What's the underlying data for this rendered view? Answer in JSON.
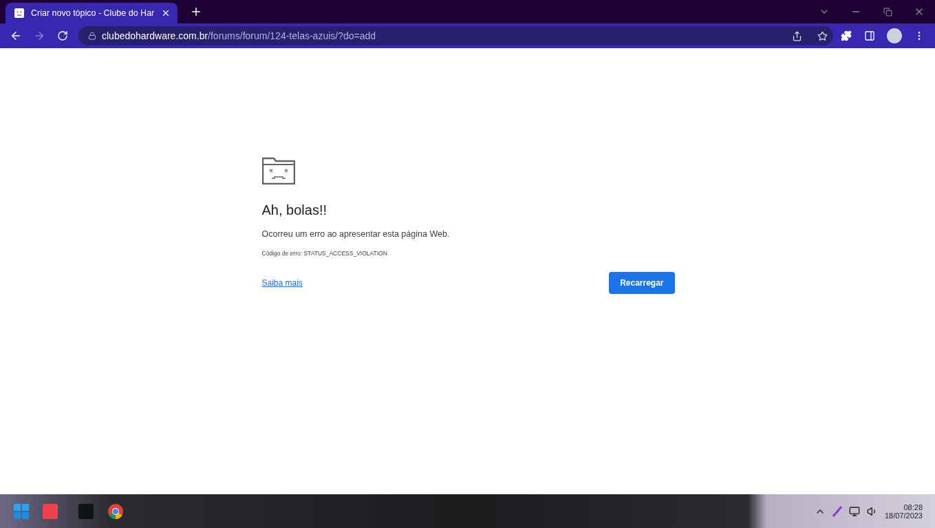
{
  "browser": {
    "tab": {
      "title": "Criar novo tópico - Clube do Har",
      "selected": true
    },
    "address": {
      "domain": "clubedohardware.com.br",
      "path": "/forums/forum/124-telas-azuis/?do=add"
    }
  },
  "error_page": {
    "heading": "Ah, bolas!!",
    "message": "Ocorreu um erro ao apresentar esta página Web.",
    "error_code": "Código de erro: STATUS_ACCESS_VIOLATION",
    "link": "Saiba mais",
    "button": "Recarregar"
  },
  "taskbar": {
    "time": "08:28",
    "date": "18/07/2023"
  }
}
